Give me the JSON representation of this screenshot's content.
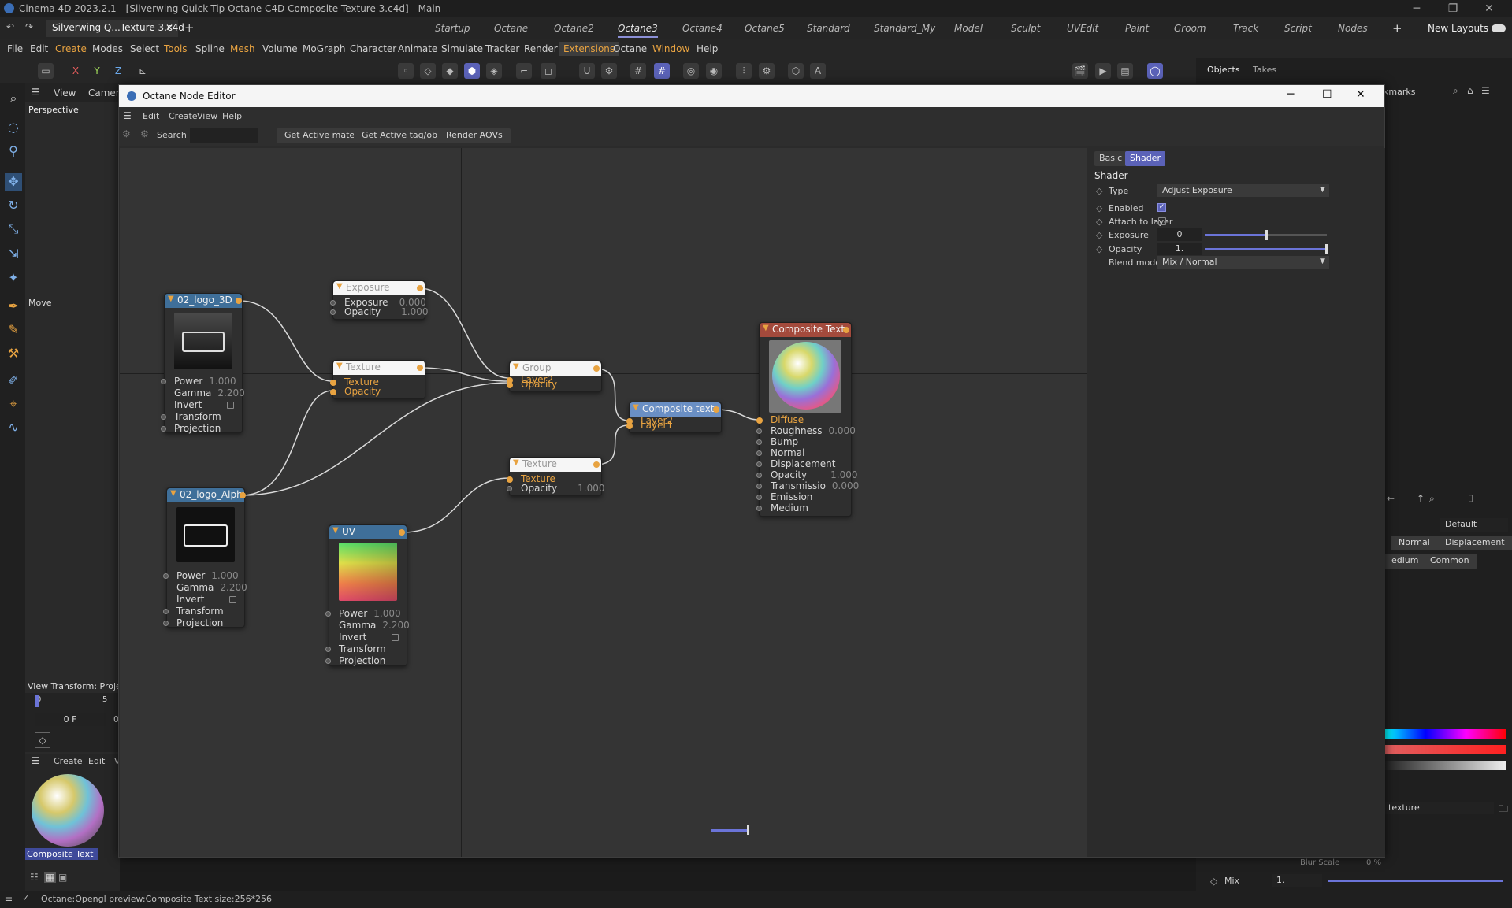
{
  "window_title": "Cinema 4D 2023.2.1 - [Silverwing Quick-Tip Octane C4D Composite Texture 3.c4d] - Main",
  "doc_tab": "Silverwing Q...Texture 3.c4d",
  "layouts": [
    "Startup",
    "Octane",
    "Octane2",
    "Octane3",
    "Octane4",
    "Octane5",
    "Standard",
    "Standard_My",
    "Model",
    "Sculpt",
    "UVEdit",
    "Paint",
    "Groom",
    "Track",
    "Script",
    "Nodes"
  ],
  "new_layouts": "New Layouts",
  "menus": [
    "File",
    "Edit",
    "Create",
    "Modes",
    "Select",
    "Tools",
    "Spline",
    "Mesh",
    "Volume",
    "MoGraph",
    "Character",
    "Animate",
    "Simulate",
    "Tracker",
    "Render",
    "Extensions",
    "Octane",
    "Window",
    "Help"
  ],
  "axes": [
    "X",
    "Y",
    "Z"
  ],
  "viewport": {
    "view": "View",
    "cameras": "Cameras",
    "name": "Perspective",
    "move": "Move",
    "view_transform": "View Transform: Proje",
    "frame": "0 F",
    "frame_end": "0",
    "timeline_ticks": [
      "0",
      "5"
    ]
  },
  "material_mgr": {
    "create": "Create",
    "edit": "Edit",
    "v": "V",
    "material_name": "Composite Text"
  },
  "right_panel": {
    "objects": "Objects",
    "takes": "Takes",
    "bookmarks": "kmarks",
    "default": "Default",
    "normal_tab": "Normal",
    "displacement_tab": "Displacement",
    "edium": "edium",
    "common": "Common",
    "texture_field": "texture",
    "blur_scale": "Blur Scale",
    "blur_value": "0 %",
    "mix_label": "Mix",
    "mix_value": "1."
  },
  "status": "Octane:Opengl preview:Composite Text  size:256*256",
  "node_editor": {
    "title": "Octane Node Editor",
    "menus": [
      "Edit",
      "Create",
      "View",
      "Help"
    ],
    "search_label": "Search",
    "buttons": [
      "Get Active material",
      "Get Active tag/object",
      "Render AOVs"
    ],
    "nodes": {
      "logo3d": {
        "title": "02_logo_3D",
        "params": [
          {
            "l": "Power",
            "v": "1.000"
          },
          {
            "l": "Gamma",
            "v": "2.200"
          },
          {
            "l": "Invert",
            "v": ""
          },
          {
            "l": "Transform",
            "v": ""
          },
          {
            "l": "Projection",
            "v": ""
          }
        ]
      },
      "logoalpha": {
        "title": "02_logo_Alpha",
        "params": [
          {
            "l": "Power",
            "v": "1.000"
          },
          {
            "l": "Gamma",
            "v": "2.200"
          },
          {
            "l": "Invert",
            "v": ""
          },
          {
            "l": "Transform",
            "v": ""
          },
          {
            "l": "Projection",
            "v": ""
          }
        ]
      },
      "uv": {
        "title": "UV",
        "params": [
          {
            "l": "Power",
            "v": "1.000"
          },
          {
            "l": "Gamma",
            "v": "2.200"
          },
          {
            "l": "Invert",
            "v": ""
          },
          {
            "l": "Transform",
            "v": ""
          },
          {
            "l": "Projection",
            "v": ""
          }
        ]
      },
      "exposure": {
        "title": "Exposure",
        "params": [
          {
            "l": "Exposure",
            "v": "0.000"
          },
          {
            "l": "Opacity",
            "v": "1.000"
          }
        ]
      },
      "texture1": {
        "title": "Texture",
        "params": [
          {
            "l": "Texture",
            "v": ""
          },
          {
            "l": "Opacity",
            "v": ""
          }
        ]
      },
      "group": {
        "title": "Group",
        "params": [
          {
            "l": "Layer2",
            "v": ""
          },
          {
            "l": "Opacity",
            "v": ""
          }
        ]
      },
      "texture2": {
        "title": "Texture",
        "params": [
          {
            "l": "Texture",
            "v": ""
          },
          {
            "l": "Opacity",
            "v": "1.000"
          }
        ]
      },
      "composite": {
        "title": "Composite textur",
        "params": [
          {
            "l": "Layer2",
            "v": ""
          },
          {
            "l": "Layer1",
            "v": ""
          }
        ]
      },
      "comptext": {
        "title": "Composite Text",
        "params": [
          {
            "l": "Diffuse",
            "v": ""
          },
          {
            "l": "Roughness",
            "v": "0.000"
          },
          {
            "l": "Bump",
            "v": ""
          },
          {
            "l": "Normal",
            "v": ""
          },
          {
            "l": "Displacement",
            "v": ""
          },
          {
            "l": "Opacity",
            "v": "1.000"
          },
          {
            "l": "Transmissio",
            "v": "0.000"
          },
          {
            "l": "Emission",
            "v": ""
          },
          {
            "l": "Medium",
            "v": ""
          }
        ]
      }
    },
    "attributes": {
      "tabs": [
        "Basic",
        "Shader"
      ],
      "section": "Shader",
      "type_label": "Type",
      "type_value": "Adjust Exposure",
      "enabled_label": "Enabled",
      "enabled": true,
      "attach_label": "Attach to layer",
      "attach": false,
      "exposure_label": "Exposure",
      "exposure_value": "0",
      "exposure_slider": 0.5,
      "opacity_label": "Opacity",
      "opacity_value": "1.",
      "opacity_slider": 1.0,
      "blend_label": "Blend mode",
      "blend_value": "Mix / Normal"
    }
  }
}
